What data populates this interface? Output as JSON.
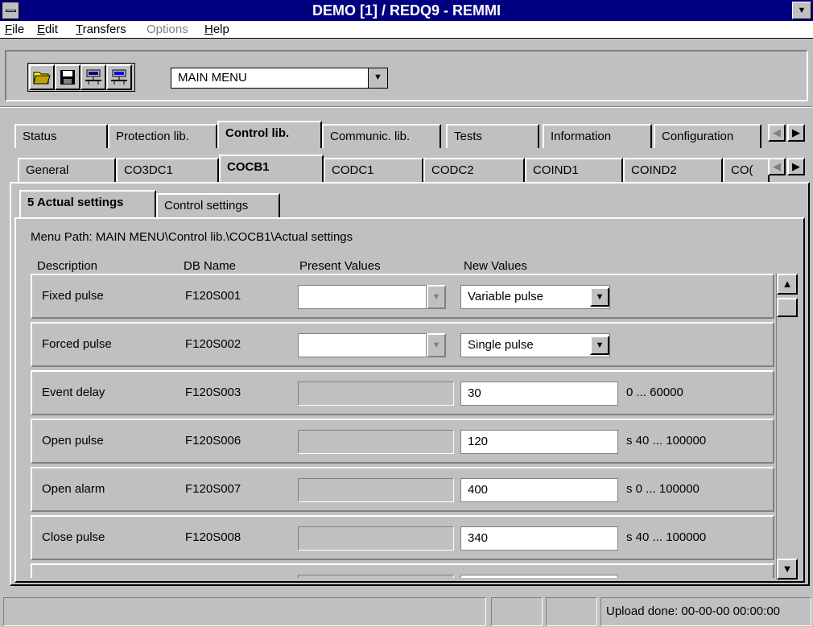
{
  "window": {
    "title": "DEMO [1] / REDQ9 - REMMI"
  },
  "menubar": [
    {
      "label": "File",
      "key": "F",
      "rest": "ile",
      "disabled": false
    },
    {
      "label": "Edit",
      "key": "E",
      "rest": "dit",
      "disabled": false
    },
    {
      "label": "Transfers",
      "key": "T",
      "rest": "ransfers",
      "disabled": false
    },
    {
      "label": "Options",
      "key": "",
      "rest": "Options",
      "disabled": true
    },
    {
      "label": "Help",
      "key": "H",
      "rest": "elp",
      "disabled": false
    }
  ],
  "toolbar": {
    "icons": [
      "open-folder-icon",
      "save-disk-icon",
      "network-send-icon",
      "network-receive-icon"
    ],
    "menu_combo": "MAIN MENU"
  },
  "tabs_level1": [
    "Status",
    "Protection lib.",
    "Control lib.",
    "Communic. lib.",
    "Tests",
    "Information",
    "Configuration"
  ],
  "tabs_level1_active": "Control lib.",
  "tabs_level2": [
    "General",
    "CO3DC1",
    "COCB1",
    "CODC1",
    "CODC2",
    "COIND1",
    "COIND2",
    "CO("
  ],
  "tabs_level2_active": "COCB1",
  "tabs_level3": [
    "5 Actual settings",
    "Control settings"
  ],
  "tabs_level3_active": "5 Actual settings",
  "menu_path": "Menu Path:  MAIN MENU\\Control lib.\\COCB1\\Actual settings",
  "columns": {
    "description": "Description",
    "db_name": "DB Name",
    "present": "Present Values",
    "new": "New Values"
  },
  "rows": [
    {
      "description": "Fixed pulse",
      "db": "F120S001",
      "type": "select",
      "present": "",
      "new": "Variable pulse",
      "range": ""
    },
    {
      "description": "Forced pulse",
      "db": "F120S002",
      "type": "select",
      "present": "",
      "new": "Single pulse",
      "range": ""
    },
    {
      "description": "Event delay",
      "db": "F120S003",
      "type": "number",
      "present": "",
      "new": "30",
      "range": "0 ... 60000"
    },
    {
      "description": "Open pulse",
      "db": "F120S006",
      "type": "number",
      "present": "",
      "new": "120",
      "range": "s 40 ... 100000"
    },
    {
      "description": "Open alarm",
      "db": "F120S007",
      "type": "number",
      "present": "",
      "new": "400",
      "range": "s 0 ... 100000"
    },
    {
      "description": "Close pulse",
      "db": "F120S008",
      "type": "number",
      "present": "",
      "new": "340",
      "range": "s 40 ... 100000"
    }
  ],
  "statusbar": {
    "message": "",
    "panel2": "",
    "panel3": "",
    "upload": "Upload done: 00-00-00 00:00:00"
  }
}
